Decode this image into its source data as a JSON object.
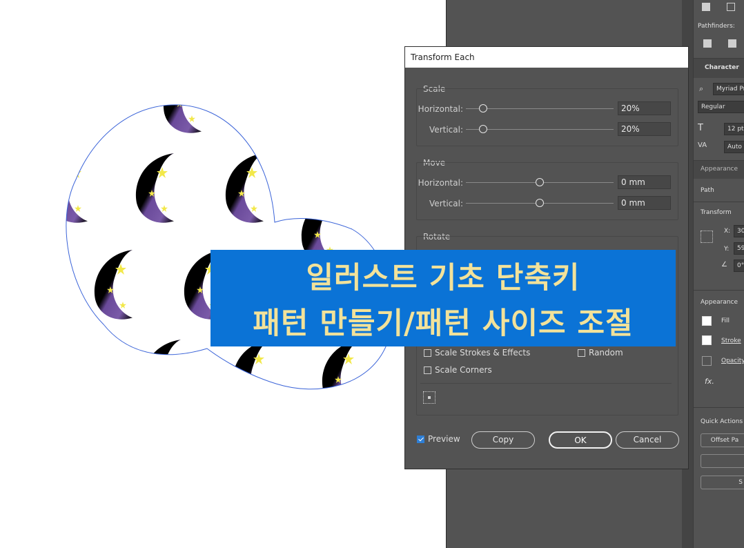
{
  "dialog": {
    "title": "Transform Each",
    "scale": {
      "label": "Scale",
      "horizontal_label": "Horizontal:",
      "horizontal_value": "20%",
      "vertical_label": "Vertical:",
      "vertical_value": "20%"
    },
    "move": {
      "label": "Move",
      "horizontal_label": "Horizontal:",
      "horizontal_value": "0 mm",
      "vertical_label": "Vertical:",
      "vertical_value": "0 mm"
    },
    "rotate": {
      "label": "Rotate"
    },
    "options": {
      "scale_strokes": "Scale Strokes & Effects",
      "scale_strokes_checked": false,
      "random": "Random",
      "random_checked": false,
      "scale_corners": "Scale Corners",
      "scale_corners_checked": false
    },
    "preview": {
      "label": "Preview",
      "checked": true
    },
    "buttons": {
      "copy": "Copy",
      "ok": "OK",
      "cancel": "Cancel"
    }
  },
  "banner": {
    "line1": "일러스트 기초 단축키",
    "line2": "패턴 만들기/패턴 사이즈 조절",
    "bg_color": "#0b73d6",
    "text_color": "#f2e29a"
  },
  "right_panel": {
    "pathfinders_label": "Pathfinders:",
    "character_tab": "Character",
    "font_family": "Myriad Pr",
    "font_style": "Regular",
    "font_size": "12 pt",
    "tracking": "Auto",
    "appearance_tab": "Appearance",
    "path_label": "Path",
    "transform_label": "Transform",
    "x_label": "X:",
    "x_value": "30",
    "y_label": "Y:",
    "y_value": "59",
    "angle_value": "0°",
    "appearance_label": "Appearance",
    "fill_label": "Fill",
    "stroke_label": "Stroke",
    "opacity_label": "Opacity",
    "fx_label": "fx.",
    "quick_actions_label": "Quick Actions",
    "offset_path_btn": "Offset Pa",
    "s_btn": "S"
  },
  "colors": {
    "moon_black": "#000000",
    "moon_purple": "#6a4a9a",
    "star_yellow": "#f2e84a",
    "shape_outline": "#3a63d8",
    "ui_panel": "#535353"
  }
}
